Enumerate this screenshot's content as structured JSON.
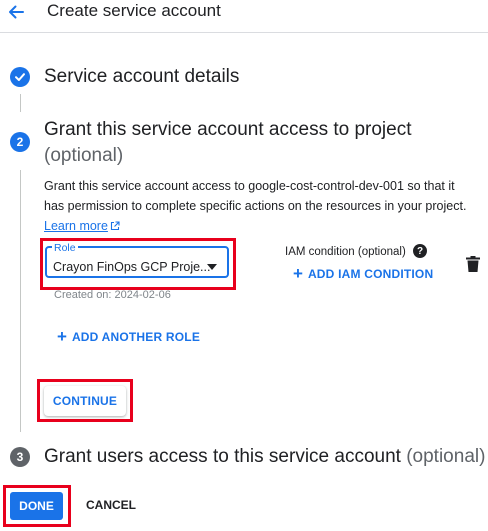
{
  "header": {
    "title": "Create service account"
  },
  "steps": {
    "step1": {
      "title": "Service account details"
    },
    "step2": {
      "number": "2",
      "title": "Grant this service account access to project",
      "optional": "(optional)",
      "description": "Grant this service account access to google-cost-control-dev-001 so that it has permission to complete specific actions on the resources in your project.",
      "learn_more": "Learn more"
    },
    "step3": {
      "number": "3",
      "title": "Grant users access to this service account",
      "optional": "(optional)"
    }
  },
  "role": {
    "label": "Role",
    "value": "Crayon FinOps GCP Proje...",
    "created": "Created on: 2024-02-06"
  },
  "iam": {
    "label": "IAM condition (optional)",
    "add_label": "ADD IAM CONDITION"
  },
  "actions": {
    "add_role": "ADD ANOTHER ROLE",
    "continue": "CONTINUE",
    "done": "DONE",
    "cancel": "CANCEL"
  },
  "colors": {
    "accent": "#1a73e8",
    "highlight": "#e8001c",
    "inactive_step": "#5f6368"
  },
  "icons": [
    "back-arrow-icon",
    "check-icon",
    "open-in-new-icon",
    "help-icon",
    "plus-icon",
    "trash-icon",
    "dropdown-caret-icon"
  ]
}
